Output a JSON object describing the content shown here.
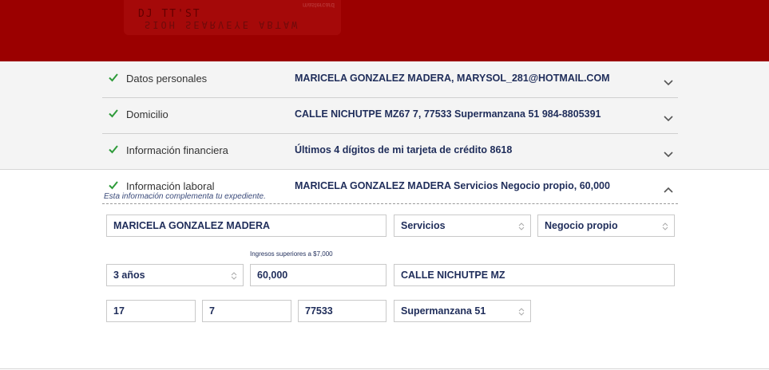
{
  "banner": {
    "card_line1": "DJ  TT'ST",
    "card_line2": "SIOH SEARVEYE ABTAW",
    "card_brand": "mastercard"
  },
  "sections": [
    {
      "title": "Datos personales",
      "summary": "MARICELA GONZALEZ MADERA, MARYSOL_281@HOTMAIL.COM",
      "state": "complete",
      "expanded": false
    },
    {
      "title": "Domicilio",
      "summary": "CALLE NICHUTPE MZ67 7, 77533 Supermanzana 51 984-8805391",
      "state": "complete",
      "expanded": false
    },
    {
      "title": "Información financiera",
      "summary": "Últimos 4 dígitos de mi tarjeta de crédito 8618",
      "state": "complete",
      "expanded": false
    }
  ],
  "laboral": {
    "title": "Información laboral",
    "summary": "MARICELA GONZALEZ MADERA Servicios Negocio propio, 60,000",
    "note": "Esta información complementa tu expediente.",
    "expanded": true
  },
  "form": {
    "employer_name": "MARICELA GONZALEZ MADERA",
    "industry": "Servicios",
    "employment_type": "Negocio propio",
    "seniority": "3 años",
    "income_hint": "Ingresos superiores a $7,000",
    "income": "60,000",
    "street": "CALLE NICHUTPE MZ",
    "ext_number": "17",
    "int_number": "7",
    "zip": "77533",
    "neighborhood": "Supermanzana 51"
  },
  "colors": {
    "banner": "#9b0000",
    "check": "#2e9b3a",
    "text_primary": "#1f2d5a"
  }
}
